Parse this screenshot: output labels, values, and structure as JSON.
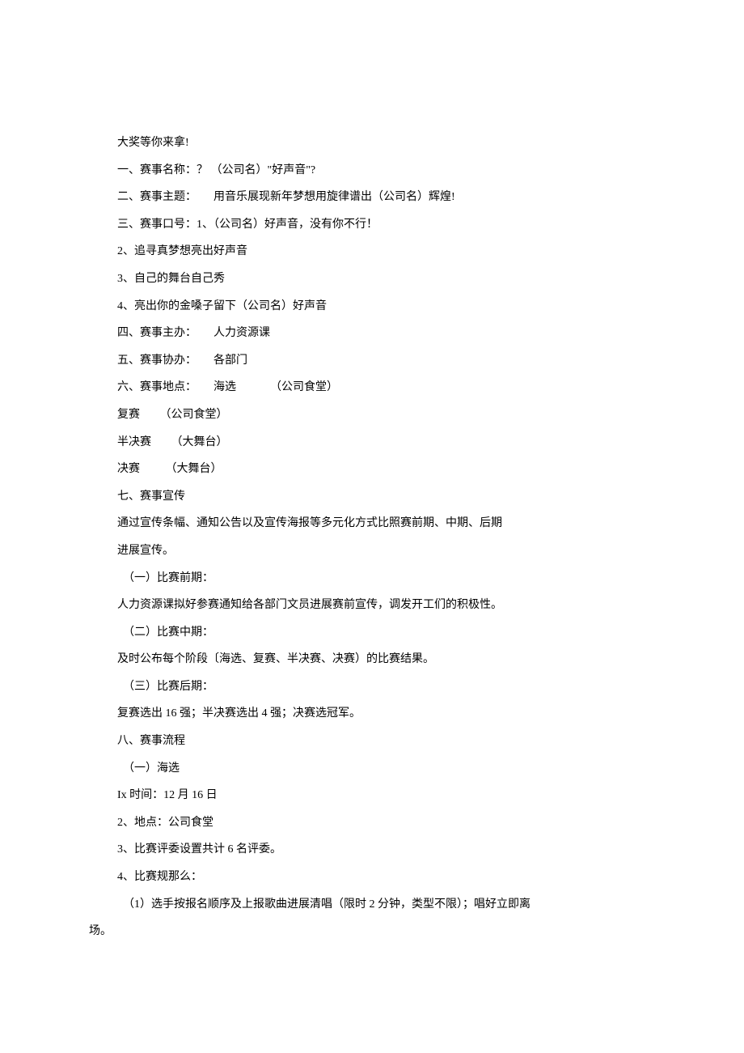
{
  "lines": [
    {
      "cls": "indent-1",
      "text": "大奖等你来拿!"
    },
    {
      "cls": "indent-1",
      "text": "一、赛事名称：？ （公司名）\"好声音\"?"
    },
    {
      "cls": "indent-1",
      "text": "二、赛事主题：      用音乐展现新年梦想用旋律谱出（公司名）辉煌!"
    },
    {
      "cls": "indent-1",
      "text": "三、赛事口号：1、（公司名）好声音，没有你不行！"
    },
    {
      "cls": "indent-1",
      "text": "2、追寻真梦想亮出好声音"
    },
    {
      "cls": "indent-1",
      "text": "3、自己的舞台自己秀"
    },
    {
      "cls": "indent-1",
      "text": "4、亮出你的金嗓子留下（公司名）好声音"
    },
    {
      "cls": "indent-1",
      "text": "四、赛事主办：      人力资源课"
    },
    {
      "cls": "indent-1",
      "text": "五、赛事协办：      各部门"
    },
    {
      "cls": "indent-1",
      "text": "六、赛事地点：      海选            （公司食堂）"
    },
    {
      "cls": "indent-1",
      "text": "复赛       （公司食堂）"
    },
    {
      "cls": "indent-1",
      "text": "半决赛       （大舞台）"
    },
    {
      "cls": "indent-1",
      "text": "决赛         （大舞台）"
    },
    {
      "cls": "indent-1",
      "text": "七、赛事宣传"
    },
    {
      "cls": "indent-1",
      "text": "通过宣传条幅、通知公告以及宣传海报等多元化方式比照赛前期、中期、后期"
    },
    {
      "cls": "indent-1",
      "text": "进展宣传。"
    },
    {
      "cls": "indent-1",
      "text": "  （一）比赛前期："
    },
    {
      "cls": "indent-1",
      "text": "人力资源课拟好参赛通知给各部门文员进展赛前宣传，调发开工们的积极性。"
    },
    {
      "cls": "indent-1",
      "text": "  （二）比赛中期："
    },
    {
      "cls": "indent-1",
      "text": "及时公布每个阶段〔海选、复赛、半决赛、决赛）的比赛结果。"
    },
    {
      "cls": "indent-1",
      "text": "  （三）比赛后期："
    },
    {
      "cls": "indent-1",
      "text": "复赛选出 16 强；半决赛选出 4 强；决赛选冠军。"
    },
    {
      "cls": "indent-1",
      "text": "八、赛事流程"
    },
    {
      "cls": "indent-1",
      "text": "  （一）海选"
    },
    {
      "cls": "indent-1",
      "text": "Ix 时间：12 月 16 日"
    },
    {
      "cls": "indent-1",
      "text": "2、地点：公司食堂"
    },
    {
      "cls": "indent-1",
      "text": "3、比赛评委设置共计 6 名评委。"
    },
    {
      "cls": "indent-1",
      "text": "4、比赛规那么："
    },
    {
      "cls": "indent-1",
      "text": "  （1）选手按报名顺序及上报歌曲进展清唱（限时 2 分钟，类型不限）；唱好立即离"
    },
    {
      "cls": "no-indent",
      "text": "场。"
    }
  ]
}
